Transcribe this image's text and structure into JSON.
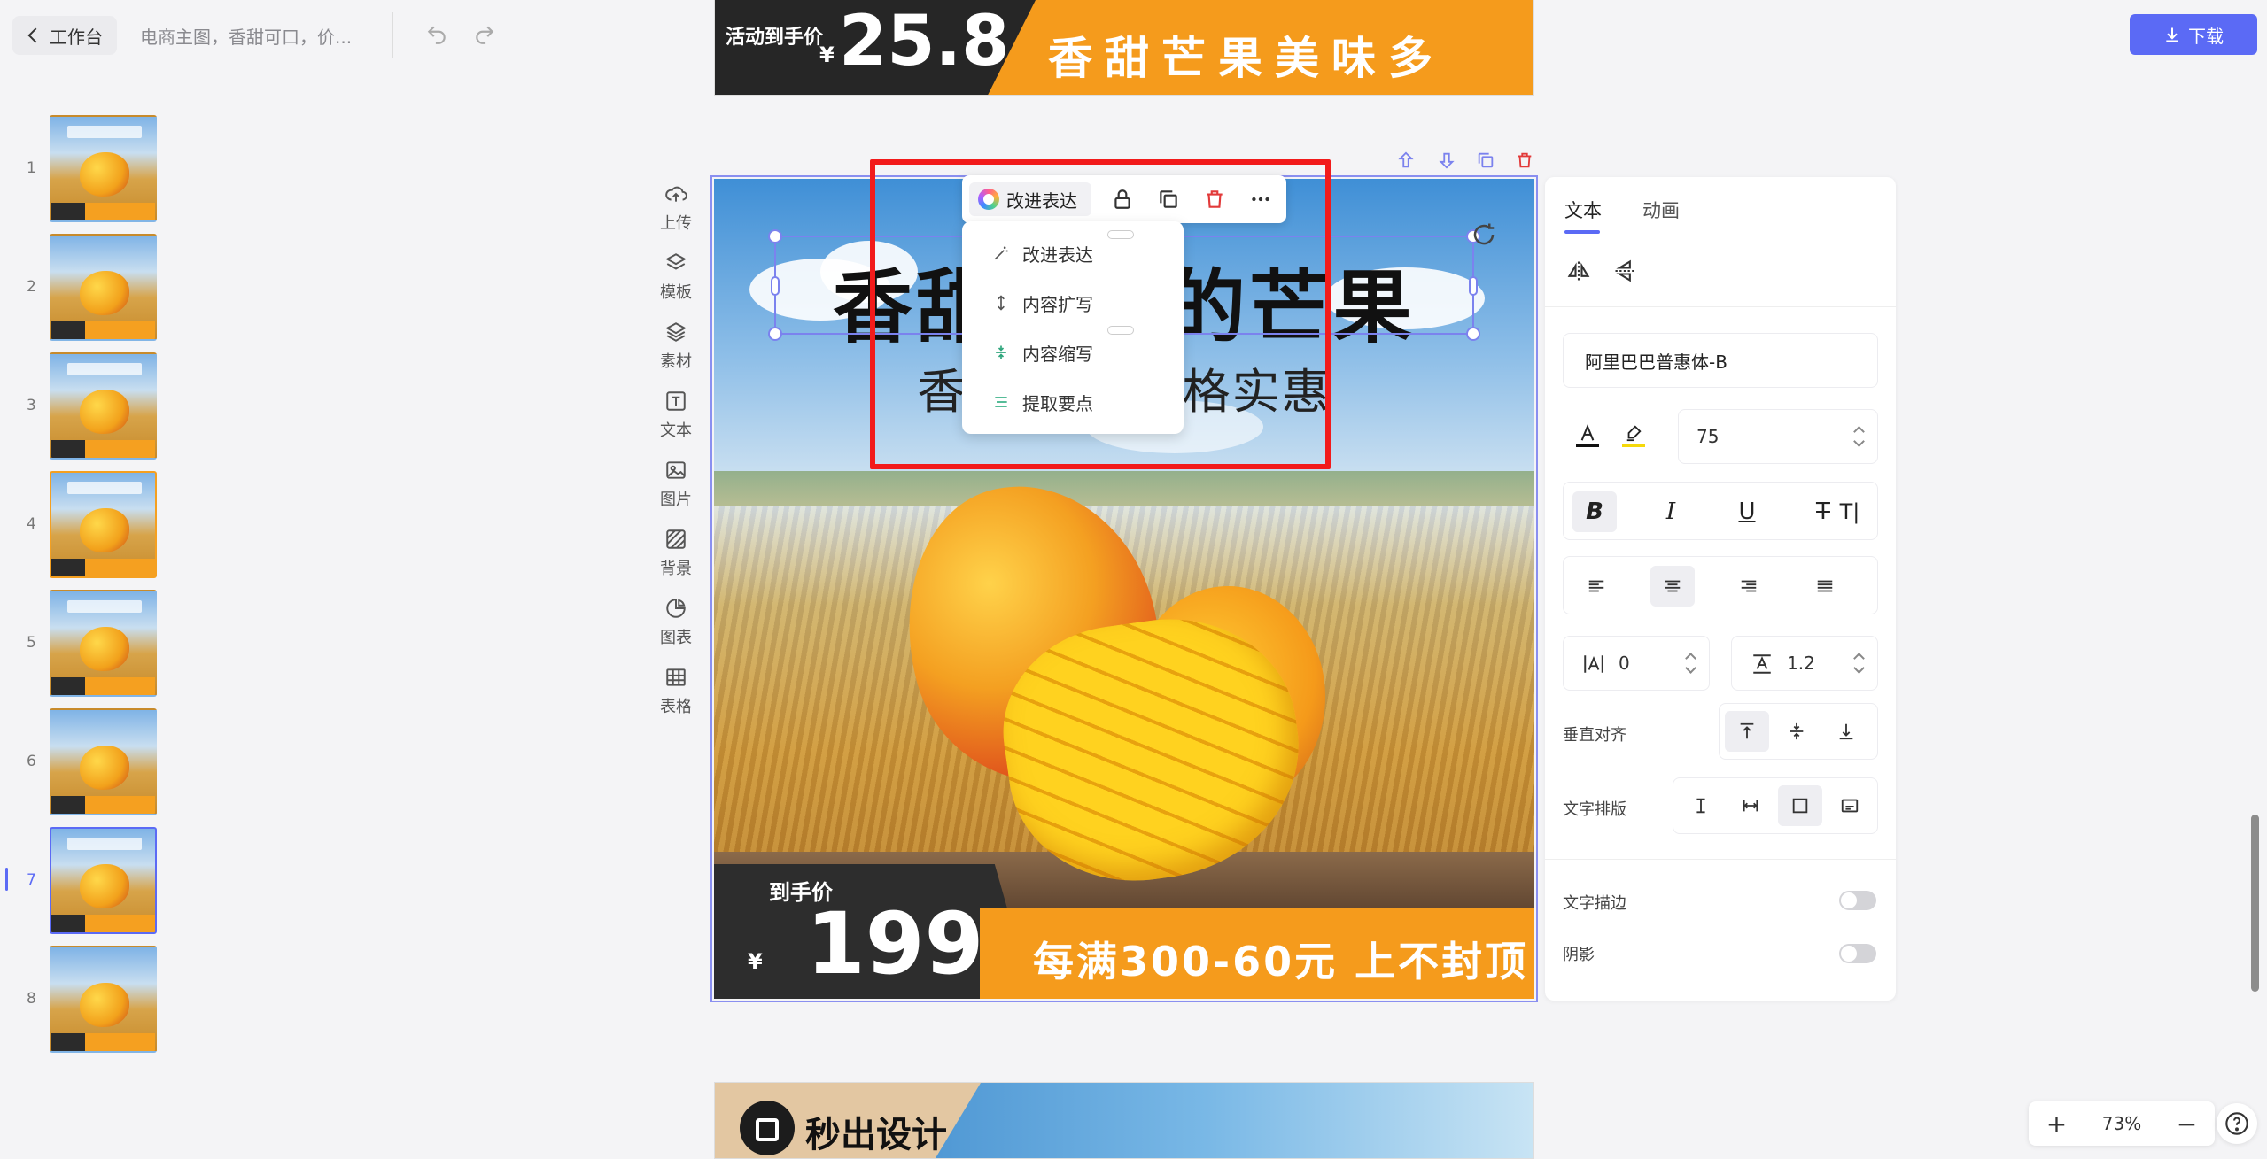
{
  "header": {
    "back_label": "工作台",
    "doc_title": "电商主图，香甜可口，价...",
    "download_label": "下载"
  },
  "pages": {
    "numbers": [
      "1",
      "2",
      "3",
      "4",
      "5",
      "6",
      "7",
      "8"
    ],
    "active": "7"
  },
  "tools": [
    "上传",
    "模板",
    "素材",
    "文本",
    "图片",
    "背景",
    "图表",
    "表格"
  ],
  "canvas": {
    "prev_page": {
      "label": "活动到手价",
      "currency": "¥",
      "price": "25.8",
      "slogan": "香甜芒果美味多"
    },
    "current_page": {
      "title": "香甜可口的芒果",
      "subtitle": "香甜可口 价格实惠",
      "price_label": "到手价",
      "currency": "¥",
      "price": "199",
      "promo": "每满300-60元 上不封顶"
    },
    "next_page": {
      "text": "秒出设计"
    }
  },
  "floating_toolbar": {
    "ai_label": "改进表达",
    "menu": [
      "改进表达",
      "内容扩写",
      "内容缩写",
      "提取要点"
    ]
  },
  "panel": {
    "tabs": [
      "文本",
      "动画"
    ],
    "font_name": "阿里巴巴普惠体-B",
    "font_size": "75",
    "letter_spacing": "0",
    "line_height": "1.2",
    "vertical_align_label": "垂直对齐",
    "text_layout_label": "文字排版",
    "stroke_label": "文字描边",
    "shadow_label": "阴影",
    "colors": {
      "text": "#111111",
      "highlight": "#f5d90a"
    }
  },
  "zoom": {
    "level": "73%"
  },
  "colors": {
    "accent": "#5b6af5",
    "highlight_box": "#f21b1b",
    "orange": "#f59b1c"
  }
}
